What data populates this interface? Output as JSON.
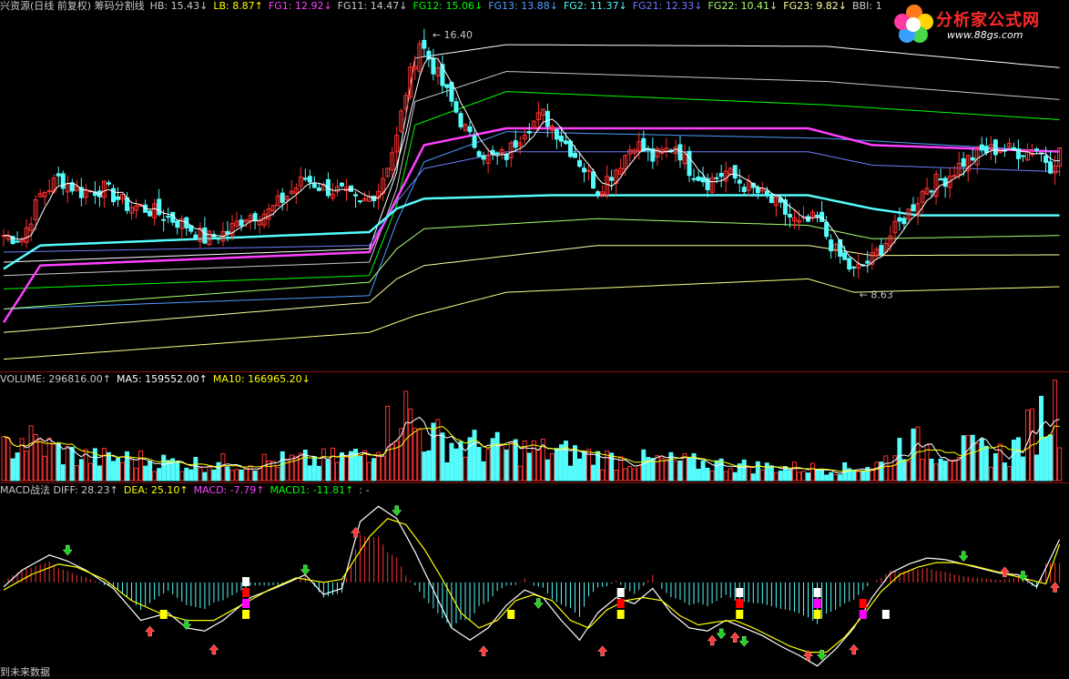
{
  "colors": {
    "up": "#ff3232",
    "down": "#54fcfc",
    "white": "#ffffff",
    "yellow": "#ffff00",
    "magenta": "#ff40ff",
    "green": "#00ff00",
    "grid": "#8a1010",
    "text": "#c8c8c8"
  },
  "logo": {
    "text": "分析家公式网",
    "url": "www.88gs.com"
  },
  "price_panel": {
    "legend": [
      {
        "text": "兴资源(日线 前复权) 筹码分割线",
        "color": "#c8c8c8"
      },
      {
        "text": "HB: 15.43↓",
        "color": "#c8c8c8"
      },
      {
        "text": "LB: 8.87↑",
        "color": "#ffff00"
      },
      {
        "text": "FG1: 12.92↓",
        "color": "#ff40ff"
      },
      {
        "text": "FG11: 14.47↓",
        "color": "#c8c8c8"
      },
      {
        "text": "FG12: 15.06↓",
        "color": "#00ff00"
      },
      {
        "text": "FG13: 13.88↓",
        "color": "#54a0ff"
      },
      {
        "text": "FG2: 11.37↓",
        "color": "#54fcfc"
      },
      {
        "text": "FG21: 12.33↓",
        "color": "#6f7cff"
      },
      {
        "text": "FG22: 10.41↓",
        "color": "#a8ff70"
      },
      {
        "text": "FG23: 9.82↓",
        "color": "#ffffa0"
      },
      {
        "text": "BBI: 1",
        "color": "#c8c8c8"
      }
    ],
    "max_label": "16.40",
    "min_label": "8.63"
  },
  "volume_panel": {
    "legend": [
      {
        "text": "VOLUME: 296816.00↑",
        "color": "#c8c8c8"
      },
      {
        "text": "MA5: 159552.00↑",
        "color": "#ffffff"
      },
      {
        "text": "MA10: 166965.20↓",
        "color": "#ffff00"
      }
    ]
  },
  "macd_panel": {
    "legend": [
      {
        "text": "MACD战法 DIFF: 28.23↑",
        "color": "#c8c8c8"
      },
      {
        "text": "DEA: 25.10↑",
        "color": "#ffff00"
      },
      {
        "text": "MACD: -7.79↑",
        "color": "#ff40ff"
      },
      {
        "text": "MACD1: -11.81↑",
        "color": "#00ff00"
      },
      {
        "text": ": -",
        "color": "#c8c8c8"
      }
    ]
  },
  "footer": "到未来数据",
  "chart_data": {
    "type": "candlestick",
    "price_range": [
      6.5,
      17.0
    ],
    "close_anchors": [
      [
        0,
        10.4
      ],
      [
        4,
        10.3
      ],
      [
        8,
        11.6
      ],
      [
        12,
        12.1
      ],
      [
        17,
        11.7
      ],
      [
        22,
        11.8
      ],
      [
        27,
        11.3
      ],
      [
        31,
        11.2
      ],
      [
        35,
        11.0
      ],
      [
        40,
        10.7
      ],
      [
        44,
        10.3
      ],
      [
        49,
        10.5
      ],
      [
        53,
        11.0
      ],
      [
        58,
        11.1
      ],
      [
        62,
        11.6
      ],
      [
        66,
        12.1
      ],
      [
        70,
        11.8
      ],
      [
        74,
        11.7
      ],
      [
        78,
        11.3
      ],
      [
        82,
        11.8
      ],
      [
        86,
        13.3
      ],
      [
        88,
        14.7
      ],
      [
        91,
        16.2
      ],
      [
        93,
        15.7
      ],
      [
        96,
        14.9
      ],
      [
        99,
        14.1
      ],
      [
        102,
        13.3
      ],
      [
        106,
        12.7
      ],
      [
        110,
        12.8
      ],
      [
        114,
        13.6
      ],
      [
        118,
        14.0
      ],
      [
        121,
        13.5
      ],
      [
        125,
        12.8
      ],
      [
        130,
        11.8
      ],
      [
        134,
        12.4
      ],
      [
        138,
        13.2
      ],
      [
        142,
        12.7
      ],
      [
        147,
        13.1
      ],
      [
        150,
        12.4
      ],
      [
        154,
        12.0
      ],
      [
        158,
        12.3
      ],
      [
        162,
        11.9
      ],
      [
        166,
        11.6
      ],
      [
        170,
        11.2
      ],
      [
        174,
        10.7
      ],
      [
        178,
        10.9
      ],
      [
        182,
        9.9
      ],
      [
        186,
        9.3
      ],
      [
        190,
        9.7
      ],
      [
        194,
        10.4
      ],
      [
        198,
        11.1
      ],
      [
        202,
        11.9
      ],
      [
        206,
        12.1
      ],
      [
        210,
        12.6
      ],
      [
        214,
        12.9
      ],
      [
        218,
        13.0
      ],
      [
        222,
        12.9
      ],
      [
        226,
        13.0
      ],
      [
        229,
        12.5
      ],
      [
        231,
        12.9
      ]
    ],
    "band_lines": [
      {
        "name": "HB",
        "anchors": [
          [
            0,
            9.6
          ],
          [
            80,
            10.0
          ],
          [
            86,
            12.3
          ],
          [
            90,
            15.7
          ],
          [
            110,
            16.1
          ],
          [
            180,
            16.05
          ],
          [
            232,
            15.4
          ]
        ]
      },
      {
        "name": "FG11",
        "anchors": [
          [
            0,
            9.2
          ],
          [
            80,
            9.6
          ],
          [
            86,
            11.8
          ],
          [
            90,
            14.4
          ],
          [
            110,
            15.3
          ],
          [
            180,
            15.0
          ],
          [
            232,
            14.45
          ]
        ]
      },
      {
        "name": "FG12",
        "anchors": [
          [
            0,
            8.8
          ],
          [
            80,
            9.2
          ],
          [
            86,
            11.3
          ],
          [
            90,
            13.7
          ],
          [
            110,
            14.7
          ],
          [
            180,
            14.3
          ],
          [
            232,
            13.85
          ]
        ]
      },
      {
        "name": "FG13",
        "anchors": [
          [
            0,
            8.2
          ],
          [
            80,
            8.6
          ],
          [
            86,
            10.8
          ],
          [
            92,
            12.6
          ],
          [
            110,
            13.5
          ],
          [
            180,
            13.3
          ],
          [
            232,
            12.9
          ]
        ]
      },
      {
        "name": "FG1",
        "anchors": [
          [
            0,
            7.8
          ],
          [
            8,
            9.5
          ],
          [
            80,
            9.9
          ],
          [
            86,
            11.5
          ],
          [
            92,
            13.1
          ],
          [
            110,
            13.6
          ],
          [
            176,
            13.6
          ],
          [
            190,
            13.1
          ],
          [
            232,
            12.9
          ]
        ]
      },
      {
        "name": "FG21",
        "anchors": [
          [
            0,
            9.9
          ],
          [
            80,
            10.1
          ],
          [
            86,
            11.4
          ],
          [
            92,
            12.4
          ],
          [
            110,
            12.9
          ],
          [
            176,
            12.9
          ],
          [
            190,
            12.5
          ],
          [
            232,
            12.3
          ]
        ]
      },
      {
        "name": "FG2",
        "anchors": [
          [
            0,
            9.4
          ],
          [
            8,
            10.1
          ],
          [
            80,
            10.5
          ],
          [
            86,
            11.2
          ],
          [
            92,
            11.5
          ],
          [
            120,
            11.6
          ],
          [
            176,
            11.6
          ],
          [
            190,
            11.2
          ],
          [
            200,
            11.0
          ],
          [
            232,
            11.0
          ]
        ]
      },
      {
        "name": "FG22",
        "anchors": [
          [
            0,
            8.2
          ],
          [
            80,
            9.0
          ],
          [
            86,
            10.0
          ],
          [
            92,
            10.6
          ],
          [
            130,
            10.9
          ],
          [
            176,
            10.7
          ],
          [
            190,
            10.3
          ],
          [
            232,
            10.4
          ]
        ]
      },
      {
        "name": "FG23",
        "anchors": [
          [
            0,
            7.5
          ],
          [
            80,
            8.4
          ],
          [
            86,
            9.1
          ],
          [
            92,
            9.5
          ],
          [
            130,
            10.1
          ],
          [
            176,
            10.1
          ],
          [
            190,
            9.8
          ],
          [
            232,
            9.82
          ]
        ]
      },
      {
        "name": "LB",
        "anchors": [
          [
            0,
            6.7
          ],
          [
            80,
            7.5
          ],
          [
            90,
            8.0
          ],
          [
            110,
            8.7
          ],
          [
            176,
            9.1
          ],
          [
            186,
            8.7
          ],
          [
            232,
            8.87
          ]
        ]
      }
    ],
    "volume_range": [
      0,
      330000
    ],
    "volume_anchors": [
      [
        0,
        110000
      ],
      [
        4,
        150000
      ],
      [
        8,
        130000
      ],
      [
        14,
        95000
      ],
      [
        20,
        80000
      ],
      [
        30,
        75000
      ],
      [
        40,
        60000
      ],
      [
        50,
        65000
      ],
      [
        60,
        70000
      ],
      [
        70,
        75000
      ],
      [
        78,
        90000
      ],
      [
        84,
        190000
      ],
      [
        87,
        280000
      ],
      [
        90,
        190000
      ],
      [
        95,
        150000
      ],
      [
        100,
        130000
      ],
      [
        108,
        115000
      ],
      [
        115,
        110000
      ],
      [
        125,
        95000
      ],
      [
        135,
        75000
      ],
      [
        145,
        70000
      ],
      [
        155,
        60000
      ],
      [
        165,
        50000
      ],
      [
        175,
        45000
      ],
      [
        185,
        42000
      ],
      [
        192,
        60000
      ],
      [
        197,
        140000
      ],
      [
        202,
        120000
      ],
      [
        210,
        110000
      ],
      [
        220,
        95000
      ],
      [
        231,
        296816
      ]
    ],
    "macd_range": [
      -60,
      55
    ],
    "diff_anchors": [
      [
        0,
        -3
      ],
      [
        4,
        8
      ],
      [
        10,
        18
      ],
      [
        14,
        14
      ],
      [
        18,
        8
      ],
      [
        24,
        -4
      ],
      [
        30,
        -25
      ],
      [
        36,
        -20
      ],
      [
        40,
        -30
      ],
      [
        44,
        -32
      ],
      [
        48,
        -25
      ],
      [
        54,
        -10
      ],
      [
        60,
        -3
      ],
      [
        66,
        5
      ],
      [
        70,
        -8
      ],
      [
        74,
        -4
      ],
      [
        78,
        40
      ],
      [
        82,
        50
      ],
      [
        86,
        42
      ],
      [
        90,
        20
      ],
      [
        94,
        -5
      ],
      [
        98,
        -30
      ],
      [
        102,
        -38
      ],
      [
        106,
        -30
      ],
      [
        110,
        -15
      ],
      [
        114,
        -5
      ],
      [
        118,
        -10
      ],
      [
        122,
        -25
      ],
      [
        126,
        -38
      ],
      [
        130,
        -20
      ],
      [
        134,
        -10
      ],
      [
        138,
        -14
      ],
      [
        142,
        -4
      ],
      [
        146,
        -20
      ],
      [
        150,
        -30
      ],
      [
        154,
        -32
      ],
      [
        158,
        -25
      ],
      [
        162,
        -30
      ],
      [
        166,
        -35
      ],
      [
        170,
        -42
      ],
      [
        174,
        -48
      ],
      [
        178,
        -55
      ],
      [
        182,
        -44
      ],
      [
        186,
        -30
      ],
      [
        190,
        -10
      ],
      [
        194,
        6
      ],
      [
        198,
        12
      ],
      [
        202,
        16
      ],
      [
        206,
        15
      ],
      [
        210,
        12
      ],
      [
        214,
        9
      ],
      [
        218,
        6
      ],
      [
        222,
        5
      ],
      [
        226,
        -3
      ],
      [
        231,
        28.23
      ]
    ],
    "dea_anchors": [
      [
        0,
        -5
      ],
      [
        6,
        5
      ],
      [
        12,
        12
      ],
      [
        16,
        10
      ],
      [
        22,
        2
      ],
      [
        28,
        -12
      ],
      [
        34,
        -20
      ],
      [
        40,
        -25
      ],
      [
        46,
        -25
      ],
      [
        52,
        -15
      ],
      [
        58,
        -5
      ],
      [
        64,
        3
      ],
      [
        70,
        0
      ],
      [
        74,
        2
      ],
      [
        80,
        30
      ],
      [
        84,
        42
      ],
      [
        88,
        38
      ],
      [
        92,
        22
      ],
      [
        96,
        2
      ],
      [
        100,
        -20
      ],
      [
        104,
        -30
      ],
      [
        108,
        -25
      ],
      [
        112,
        -12
      ],
      [
        116,
        -8
      ],
      [
        120,
        -12
      ],
      [
        124,
        -25
      ],
      [
        128,
        -30
      ],
      [
        132,
        -18
      ],
      [
        136,
        -12
      ],
      [
        140,
        -10
      ],
      [
        144,
        -12
      ],
      [
        148,
        -22
      ],
      [
        152,
        -28
      ],
      [
        156,
        -26
      ],
      [
        160,
        -25
      ],
      [
        164,
        -30
      ],
      [
        168,
        -36
      ],
      [
        172,
        -42
      ],
      [
        176,
        -46
      ],
      [
        180,
        -46
      ],
      [
        184,
        -36
      ],
      [
        188,
        -22
      ],
      [
        192,
        -6
      ],
      [
        196,
        5
      ],
      [
        200,
        10
      ],
      [
        204,
        13
      ],
      [
        208,
        13
      ],
      [
        212,
        11
      ],
      [
        216,
        8
      ],
      [
        220,
        5
      ],
      [
        224,
        2
      ],
      [
        228,
        -1
      ],
      [
        231,
        25.1
      ]
    ],
    "signals": [
      {
        "type": "down",
        "i": 14,
        "v": 22
      },
      {
        "type": "up",
        "i": 32,
        "v": -33
      },
      {
        "type": "down",
        "i": 40,
        "v": -27
      },
      {
        "type": "up",
        "i": 46,
        "v": -45
      },
      {
        "type": "down",
        "i": 66,
        "v": 9
      },
      {
        "type": "up",
        "i": 77,
        "v": 32
      },
      {
        "type": "down",
        "i": 86,
        "v": 48
      },
      {
        "type": "up",
        "i": 105,
        "v": -46
      },
      {
        "type": "down",
        "i": 117,
        "v": -13
      },
      {
        "type": "up",
        "i": 131,
        "v": -46
      },
      {
        "type": "up",
        "i": 155,
        "v": -39
      },
      {
        "type": "down",
        "i": 157,
        "v": -33
      },
      {
        "type": "up",
        "i": 160,
        "v": -37
      },
      {
        "type": "down",
        "i": 162,
        "v": -38
      },
      {
        "type": "up",
        "i": 176,
        "v": -49
      },
      {
        "type": "down",
        "i": 179,
        "v": -47
      },
      {
        "type": "up",
        "i": 186,
        "v": -45
      },
      {
        "type": "down",
        "i": 210,
        "v": 18
      },
      {
        "type": "up",
        "i": 219,
        "v": 6
      },
      {
        "type": "down",
        "i": 223,
        "v": 5
      },
      {
        "type": "up",
        "i": 230,
        "v": -4
      }
    ],
    "markers": [
      {
        "i": 35,
        "stack": [
          "yellow"
        ]
      },
      {
        "i": 53,
        "stack": [
          "white",
          "red",
          "magenta",
          "yellow"
        ]
      },
      {
        "i": 111,
        "stack": [
          "yellow"
        ]
      },
      {
        "i": 135,
        "stack": [
          "white",
          "red",
          "yellow"
        ]
      },
      {
        "i": 161,
        "stack": [
          "white",
          "red",
          "yellow"
        ]
      },
      {
        "i": 178,
        "stack": [
          "white",
          "magenta",
          "yellow"
        ]
      },
      {
        "i": 188,
        "stack": [
          "red",
          "magenta"
        ]
      },
      {
        "i": 193,
        "stack": [
          "white"
        ]
      }
    ]
  }
}
